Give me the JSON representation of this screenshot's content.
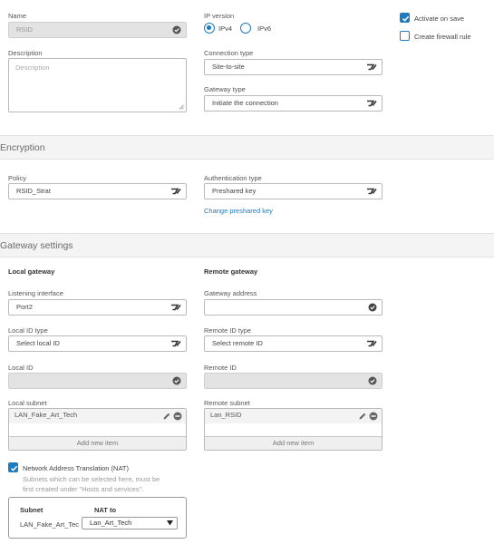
{
  "name": {
    "label": "Name",
    "value": "RSID"
  },
  "ip_version": {
    "label": "IP version",
    "options": [
      "IPv4",
      "IPv6"
    ],
    "selected": "IPv4"
  },
  "options": {
    "activate_label": "Activate on save",
    "activate_checked": true,
    "firewall_label": "Create firewall rule",
    "firewall_checked": false
  },
  "description": {
    "label": "Description",
    "placeholder": "Description"
  },
  "connection_type": {
    "label": "Connection type",
    "value": "Site-to-site"
  },
  "gateway_type": {
    "label": "Gateway type",
    "value": "Initiate the connection"
  },
  "encryption": {
    "title": "Encryption",
    "policy": {
      "label": "Policy",
      "value": "RSID_Strat"
    },
    "auth_type": {
      "label": "Authentication type",
      "value": "Preshared key"
    },
    "change_link": "Change preshared key"
  },
  "gateway_settings": {
    "title": "Gateway settings",
    "local_title": "Local gateway",
    "remote_title": "Remote gateway",
    "listening_interface": {
      "label": "Listening interface",
      "value": "Port2"
    },
    "gateway_address": {
      "label": "Gateway address",
      "value": ""
    },
    "local_id_type": {
      "label": "Local ID type",
      "value": "Select local ID"
    },
    "remote_id_type": {
      "label": "Remote ID type",
      "value": "Select remote ID"
    },
    "local_id": {
      "label": "Local ID",
      "value": ""
    },
    "remote_id": {
      "label": "Remote ID",
      "value": ""
    },
    "local_subnet": {
      "label": "Local subnet",
      "items": [
        "LAN_Fake_Art_Tech"
      ],
      "add_label": "Add new item"
    },
    "remote_subnet": {
      "label": "Remote subnet",
      "items": [
        "Lan_RSID"
      ],
      "add_label": "Add new item"
    }
  },
  "nat": {
    "label": "Network Address Translation (NAT)",
    "checked": true,
    "help": [
      "Subnets which can be selected here, must be",
      "first created under \"Hosts and services\"."
    ],
    "col_subnet": "Subnet",
    "col_nat_to": "NAT to",
    "row_subnet": "LAN_Fake_Art_Tec",
    "row_nat_to": "Lan_Art_Tech"
  },
  "colors": {
    "accent": "#1e7bbf",
    "section_bg": "#f4f4f4",
    "disabled_bg": "#e3e3e3"
  }
}
